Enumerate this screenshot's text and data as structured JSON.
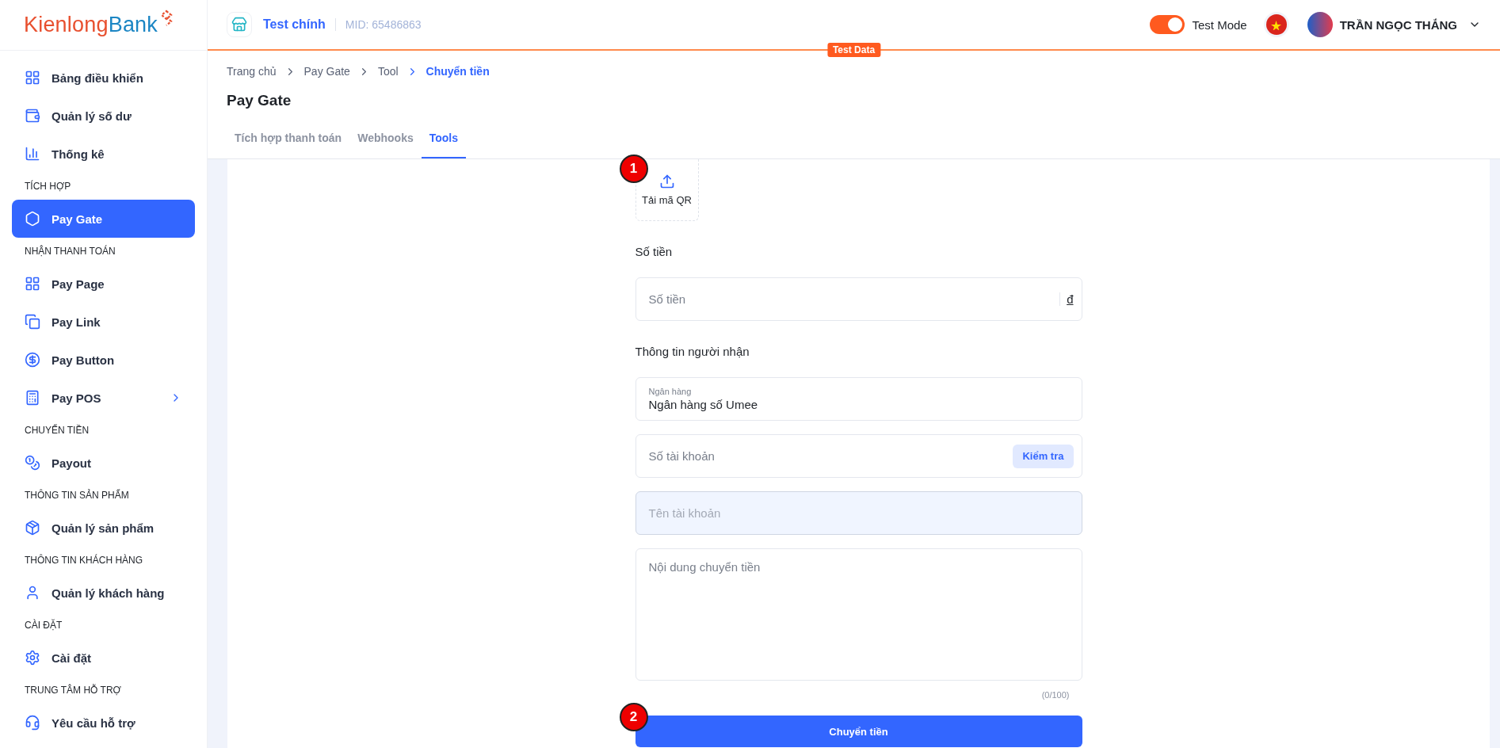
{
  "logo": {
    "first": "Kienlong",
    "second": "Bank"
  },
  "header": {
    "store_name": "Test chính",
    "merchant_id": "MID: 65486863",
    "test_mode": {
      "label": "Test Mode",
      "on": true
    },
    "user_name": "TRẦN NGỌC THẮNG",
    "badge": "Test Data"
  },
  "sidebar": {
    "groups": [
      {
        "items": [
          {
            "label": "Bảng điều khiển",
            "selected": false,
            "has_submenu": false
          },
          {
            "label": "Quản lý số dư",
            "selected": false,
            "has_submenu": false
          },
          {
            "label": "Thống kê",
            "selected": false,
            "has_submenu": false
          }
        ]
      },
      {
        "title": "TÍCH HỢP",
        "items": [
          {
            "label": "Pay Gate",
            "selected": true,
            "has_submenu": false
          }
        ]
      },
      {
        "title": "NHẬN THANH TOÁN",
        "items": [
          {
            "label": "Pay Page",
            "selected": false,
            "has_submenu": false
          },
          {
            "label": "Pay Link",
            "selected": false,
            "has_submenu": false
          },
          {
            "label": "Pay Button",
            "selected": false,
            "has_submenu": false
          },
          {
            "label": "Pay POS",
            "selected": false,
            "has_submenu": true
          }
        ]
      },
      {
        "title": "CHUYỂN TIỀN",
        "items": [
          {
            "label": "Payout",
            "selected": false,
            "has_submenu": false
          }
        ]
      },
      {
        "title": "THÔNG TIN SẢN PHẨM",
        "items": [
          {
            "label": "Quản lý sản phẩm",
            "selected": false,
            "has_submenu": false
          }
        ]
      },
      {
        "title": "THÔNG TIN KHÁCH HÀNG",
        "items": [
          {
            "label": "Quản lý khách hàng",
            "selected": false,
            "has_submenu": false
          }
        ]
      },
      {
        "title": "CÀI ĐẶT",
        "items": [
          {
            "label": "Cài đặt",
            "selected": false,
            "has_submenu": false
          }
        ]
      },
      {
        "title": "TRUNG TÂM HỖ TRỢ",
        "items": [
          {
            "label": "Yêu cầu hỗ trợ",
            "selected": false,
            "has_submenu": false
          }
        ]
      }
    ]
  },
  "breadcrumb": [
    {
      "label": "Trang chủ",
      "current": false
    },
    {
      "label": "Pay Gate",
      "current": false
    },
    {
      "label": "Tool",
      "current": false
    },
    {
      "label": "Chuyển tiền",
      "current": true
    }
  ],
  "page_title": "Pay Gate",
  "tabs": [
    {
      "label": "Tích hợp thanh toán",
      "selected": false
    },
    {
      "label": "Webhooks",
      "selected": false
    },
    {
      "label": "Tools",
      "selected": true
    }
  ],
  "form": {
    "upload": {
      "label": "Tải mã QR",
      "marker": "1"
    },
    "sections": [
      {
        "title": "Số tiền",
        "fields": [
          {
            "kind": "suffix",
            "placeholder": "Số tiền",
            "suffix": "đ"
          }
        ]
      },
      {
        "title": "Thông tin người nhận",
        "fields": [
          {
            "kind": "floating",
            "label": "Ngân hàng",
            "value": "Ngân hàng số Umee"
          },
          {
            "kind": "action",
            "placeholder": "Số tài khoản",
            "action": "Kiểm tra"
          },
          {
            "kind": "disabled",
            "placeholder": "Tên tài khoản"
          },
          {
            "kind": "textarea",
            "placeholder": "Nội dung chuyển tiền",
            "counter": "(0/100)"
          }
        ]
      }
    ],
    "submit": {
      "label": "Chuyển tiền",
      "marker": "2"
    }
  }
}
